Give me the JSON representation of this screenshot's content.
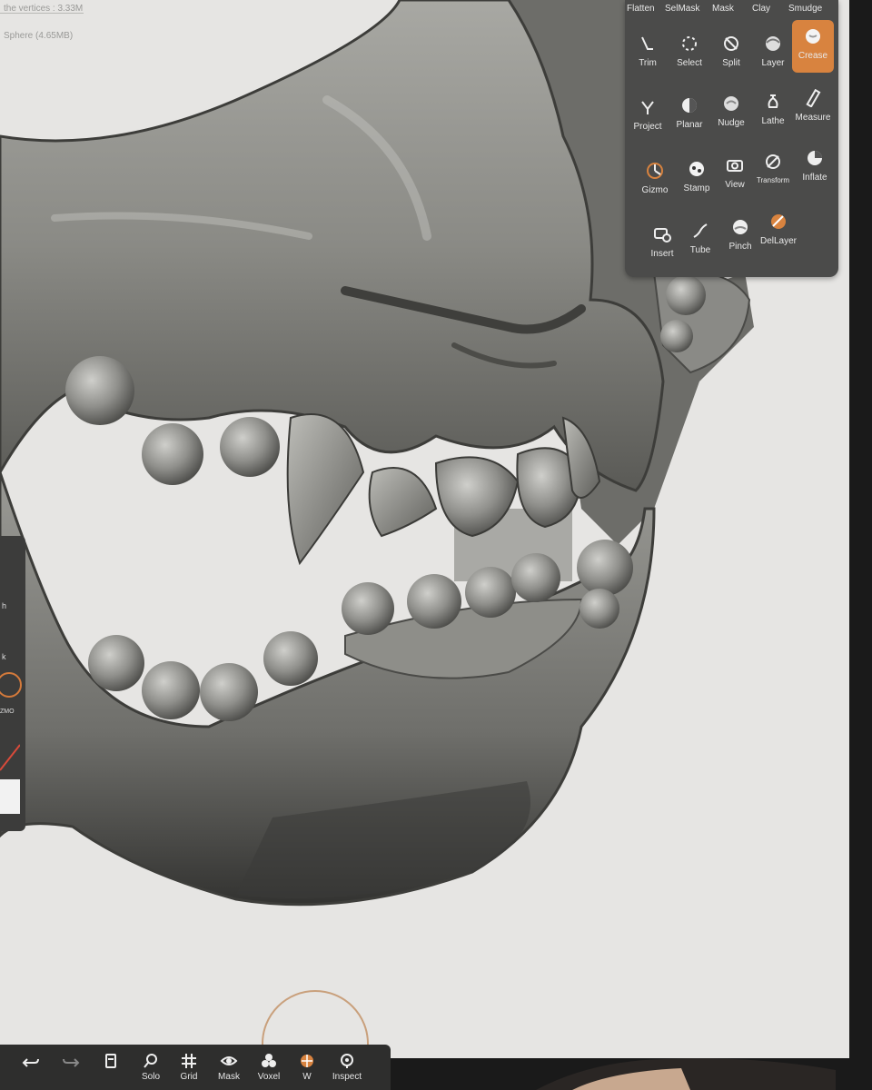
{
  "viewport_info": {
    "vertices": "the vertices : 3.33M",
    "active_object": "Sphere (4.65MB)"
  },
  "left_dock": {
    "label_a": "h",
    "label_b": "k",
    "gizmo_label": "ZMO"
  },
  "tool_panel": {
    "top_row": [
      "Flatten",
      "SelMask",
      "Mask",
      "Clay",
      "Smudge"
    ],
    "tools": [
      {
        "label": "Trim",
        "icon": "trim-icon"
      },
      {
        "label": "Select",
        "icon": "select-icon"
      },
      {
        "label": "Split",
        "icon": "split-icon"
      },
      {
        "label": "Layer",
        "icon": "layer-icon"
      },
      {
        "label": "Crease",
        "icon": "crease-icon",
        "active": true
      },
      {
        "label": "Project",
        "icon": "project-icon"
      },
      {
        "label": "Planar",
        "icon": "planar-icon"
      },
      {
        "label": "Nudge",
        "icon": "nudge-icon"
      },
      {
        "label": "Lathe",
        "icon": "lathe-icon"
      },
      {
        "label": "Measure",
        "icon": "measure-icon"
      },
      {
        "label": "Gizmo",
        "icon": "gizmo-icon"
      },
      {
        "label": "Stamp",
        "icon": "stamp-icon"
      },
      {
        "label": "View",
        "icon": "camera-icon"
      },
      {
        "label": "Transform",
        "icon": "transform-icon"
      },
      {
        "label": "Inflate",
        "icon": "inflate-icon"
      },
      {
        "label": "Insert",
        "icon": "insert-icon"
      },
      {
        "label": "Tube",
        "icon": "tube-icon"
      },
      {
        "label": "Pinch",
        "icon": "pinch-icon"
      },
      {
        "label": "DelLayer",
        "icon": "dellayer-icon"
      }
    ],
    "accent_color": "#d8833f"
  },
  "bottom_toolbar": {
    "items": [
      {
        "label": "",
        "icon": "undo-icon"
      },
      {
        "label": "",
        "icon": "redo-icon"
      },
      {
        "label": "",
        "icon": "files-icon"
      },
      {
        "label": "Solo",
        "icon": "search-icon"
      },
      {
        "label": "Grid",
        "icon": "grid-icon"
      },
      {
        "label": "Mask",
        "icon": "eye-icon"
      },
      {
        "label": "Voxel",
        "icon": "voxel-icon"
      },
      {
        "label": "W",
        "icon": "wireframe-icon"
      },
      {
        "label": "Inspect",
        "icon": "inspect-icon"
      }
    ]
  }
}
